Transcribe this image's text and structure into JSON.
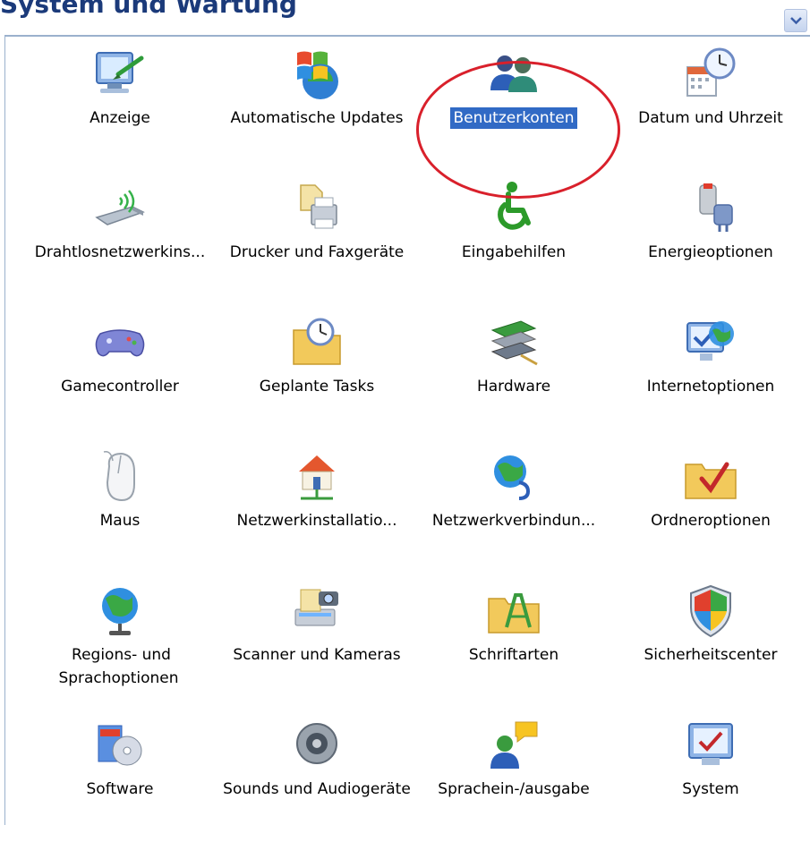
{
  "header": {
    "title_fragment": "System und Wartung"
  },
  "selected_item": "Benutzerkonten",
  "items": [
    {
      "label": "Anzeige",
      "icon": "display-icon"
    },
    {
      "label": "Automatische Updates",
      "icon": "windows-update-icon"
    },
    {
      "label": "Benutzerkonten",
      "icon": "user-accounts-icon"
    },
    {
      "label": "Datum und Uhrzeit",
      "icon": "date-time-icon"
    },
    {
      "label": "Drahtlosnetzwerkins...",
      "icon": "wireless-icon"
    },
    {
      "label": "Drucker und Faxgeräte",
      "icon": "printer-icon"
    },
    {
      "label": "Eingabehilfen",
      "icon": "accessibility-icon"
    },
    {
      "label": "Energieoptionen",
      "icon": "power-icon"
    },
    {
      "label": "Gamecontroller",
      "icon": "gamepad-icon"
    },
    {
      "label": "Geplante Tasks",
      "icon": "scheduled-tasks-icon"
    },
    {
      "label": "Hardware",
      "icon": "hardware-icon"
    },
    {
      "label": "Internetoptionen",
      "icon": "internet-options-icon"
    },
    {
      "label": "Maus",
      "icon": "mouse-icon"
    },
    {
      "label": "Netzwerkinstallatio...",
      "icon": "network-setup-icon"
    },
    {
      "label": "Netzwerkverbindun...",
      "icon": "network-connections-icon"
    },
    {
      "label": "Ordneroptionen",
      "icon": "folder-options-icon"
    },
    {
      "label": "Regions- und Sprachoptionen",
      "icon": "regional-globe-icon"
    },
    {
      "label": "Scanner und Kameras",
      "icon": "scanner-camera-icon"
    },
    {
      "label": "Schriftarten",
      "icon": "fonts-folder-icon"
    },
    {
      "label": "Sicherheitscenter",
      "icon": "security-shield-icon"
    },
    {
      "label": "Software",
      "icon": "software-icon"
    },
    {
      "label": "Sounds und Audiogeräte",
      "icon": "speaker-icon"
    },
    {
      "label": "Sprachein-/ausgabe",
      "icon": "speech-icon"
    },
    {
      "label": "System",
      "icon": "system-icon"
    }
  ],
  "colors": {
    "selection": "#316ac5",
    "annotation": "#d9202b"
  }
}
